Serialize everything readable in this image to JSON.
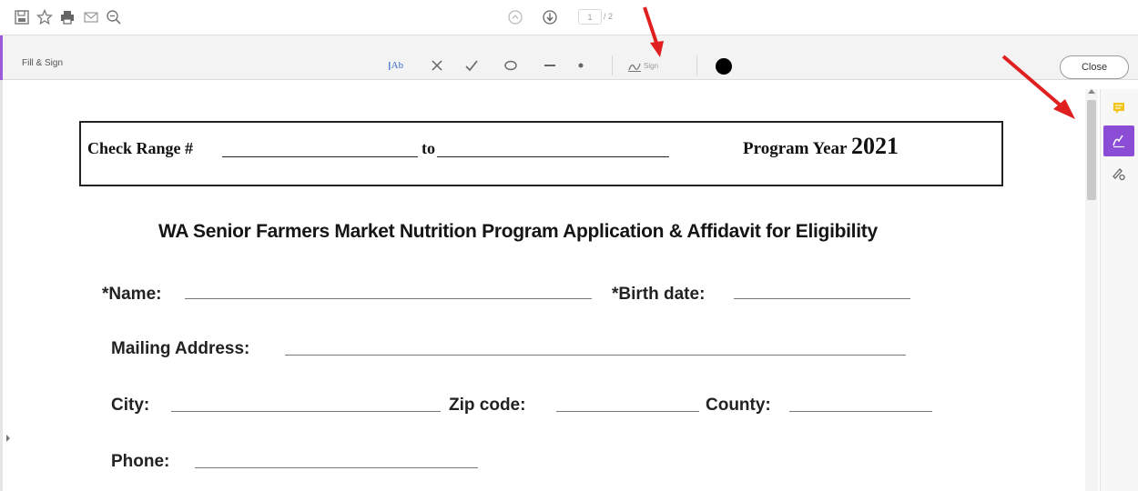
{
  "toolbar_top": {
    "icons": [
      "save-icon",
      "star-icon",
      "print-icon",
      "email-icon",
      "zoom-out-icon",
      "page-up-icon",
      "page-down-icon"
    ],
    "page_current": "1",
    "page_total": "/ 2"
  },
  "fill_sign": {
    "title": "Fill & Sign",
    "tools": [
      "add-text",
      "cross",
      "checkmark",
      "circle",
      "line",
      "dot"
    ],
    "text_tool_label": "Ab",
    "sign_label": "Sign",
    "close_label": "Close",
    "accent_color": "#9a5ad8"
  },
  "right_rail": {
    "items": [
      "comment-icon",
      "fill-sign-icon",
      "request-signature-icon"
    ],
    "active_color": "#8c4dd6"
  },
  "annotation_color": "#e02020",
  "document": {
    "check_range_label": "Check Range #",
    "to_label": "to",
    "program_year_label": "Program Year",
    "program_year": "2021",
    "form_title": "WA Senior Farmers Market Nutrition Program Application & Affidavit for Eligibility",
    "fields": {
      "name": "*Name:",
      "birth_date": "*Birth date:",
      "mailing_address": "Mailing Address:",
      "city": "City:",
      "zip": "Zip code:",
      "county": "County:",
      "phone": "Phone:"
    }
  }
}
